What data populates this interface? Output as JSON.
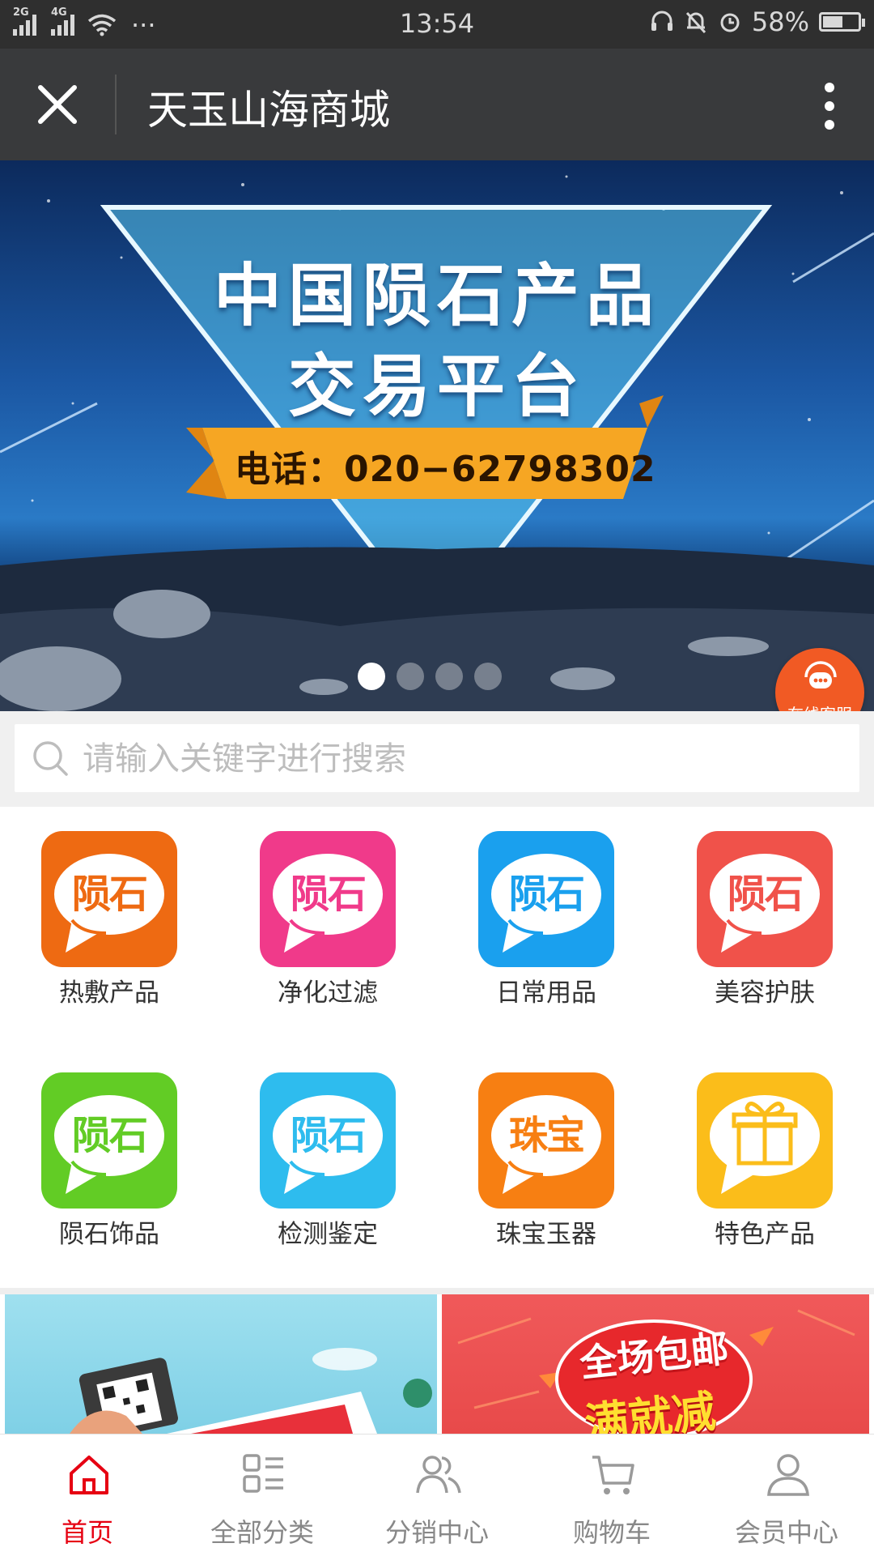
{
  "status_bar": {
    "network_1": "2G",
    "network_2": "4G",
    "more": "···",
    "time": "13:54",
    "battery": "58%",
    "battery_level": 0.58
  },
  "header": {
    "title": "天玉山海商城"
  },
  "banner": {
    "title_line1": "中国陨石产品",
    "title_line2": "交易平台",
    "phone": "电话：020−62798302",
    "slide_count": 4,
    "active_slide": 1
  },
  "service": {
    "label": "在线客服"
  },
  "search": {
    "placeholder": "请输入关键字进行搜索",
    "value": ""
  },
  "categories": [
    {
      "label": "热敷产品",
      "word": "陨石",
      "color": "#ee6a12",
      "text_color": "#ee6a12"
    },
    {
      "label": "净化过滤",
      "word": "陨石",
      "color": "#f03a8a",
      "text_color": "#f03a8a"
    },
    {
      "label": "日常用品",
      "word": "陨石",
      "color": "#1aa0ee",
      "text_color": "#1aa0ee"
    },
    {
      "label": "美容护肤",
      "word": "陨石",
      "color": "#f0524a",
      "text_color": "#f0524a"
    },
    {
      "label": "陨石饰品",
      "word": "陨石",
      "color": "#62cc25",
      "text_color": "#62cc25"
    },
    {
      "label": "检测鉴定",
      "word": "陨石",
      "color": "#2ebcee",
      "text_color": "#2ebcee"
    },
    {
      "label": "珠宝玉器",
      "word": "珠宝",
      "color": "#f77f12",
      "text_color": "#f77f12"
    },
    {
      "label": "特色产品",
      "word": "",
      "color": "#fbbd1a",
      "text_color": "#fbbd1a"
    }
  ],
  "promo": {
    "right_line1": "全场包邮",
    "right_line2": "满就减"
  },
  "nav": [
    {
      "label": "首页",
      "icon": "home-icon",
      "active": true
    },
    {
      "label": "全部分类",
      "icon": "category-icon",
      "active": false
    },
    {
      "label": "分销中心",
      "icon": "users-icon",
      "active": false
    },
    {
      "label": "购物车",
      "icon": "cart-icon",
      "active": false
    },
    {
      "label": "会员中心",
      "icon": "user-icon",
      "active": false
    }
  ],
  "colors": {
    "accent": "#e60012",
    "title_bar": "#393a3c",
    "status_bar": "#2f2f2f",
    "service": "#f15a24"
  }
}
